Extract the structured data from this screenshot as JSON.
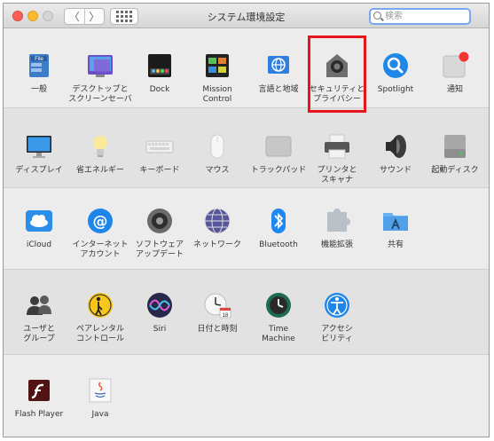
{
  "window": {
    "title": "システム環境設定"
  },
  "toolbar": {
    "back": "〈",
    "forward": "〉"
  },
  "search": {
    "placeholder": "検索"
  },
  "rows": [
    [
      {
        "name": "general",
        "label": "一般",
        "icon": "general-icon"
      },
      {
        "name": "desktop-screensaver",
        "label": "デスクトップと\nスクリーンセーバ",
        "icon": "desktop-icon"
      },
      {
        "name": "dock",
        "label": "Dock",
        "icon": "dock-icon"
      },
      {
        "name": "mission-control",
        "label": "Mission\nControl",
        "icon": "mission-control-icon"
      },
      {
        "name": "language-region",
        "label": "言語と地域",
        "icon": "flag-icon"
      },
      {
        "name": "security-privacy",
        "label": "セキュリティと\nプライバシー",
        "icon": "house-lock-icon"
      },
      {
        "name": "spotlight",
        "label": "Spotlight",
        "icon": "magnifier-icon"
      },
      {
        "name": "notifications",
        "label": "通知",
        "icon": "notifications-icon"
      }
    ],
    [
      {
        "name": "displays",
        "label": "ディスプレイ",
        "icon": "display-icon"
      },
      {
        "name": "energy-saver",
        "label": "省エネルギー",
        "icon": "lightbulb-icon"
      },
      {
        "name": "keyboard",
        "label": "キーボード",
        "icon": "keyboard-icon"
      },
      {
        "name": "mouse",
        "label": "マウス",
        "icon": "mouse-icon"
      },
      {
        "name": "trackpad",
        "label": "トラックパッド",
        "icon": "trackpad-icon"
      },
      {
        "name": "printers-scanners",
        "label": "プリンタと\nスキャナ",
        "icon": "printer-icon"
      },
      {
        "name": "sound",
        "label": "サウンド",
        "icon": "speaker-icon"
      },
      {
        "name": "startup-disk",
        "label": "起動ディスク",
        "icon": "disk-icon"
      }
    ],
    [
      {
        "name": "icloud",
        "label": "iCloud",
        "icon": "cloud-icon"
      },
      {
        "name": "internet-accounts",
        "label": "インターネット\nアカウント",
        "icon": "at-icon"
      },
      {
        "name": "software-update",
        "label": "ソフトウェア\nアップデート",
        "icon": "gear-icon"
      },
      {
        "name": "network",
        "label": "ネットワーク",
        "icon": "globe-icon"
      },
      {
        "name": "bluetooth",
        "label": "Bluetooth",
        "icon": "bluetooth-icon"
      },
      {
        "name": "extensions",
        "label": "機能拡張",
        "icon": "puzzle-icon"
      },
      {
        "name": "sharing",
        "label": "共有",
        "icon": "sharing-folder-icon"
      }
    ],
    [
      {
        "name": "users-groups",
        "label": "ユーザと\nグループ",
        "icon": "users-icon"
      },
      {
        "name": "parental-controls",
        "label": "ペアレンタル\nコントロール",
        "icon": "parental-icon"
      },
      {
        "name": "siri",
        "label": "Siri",
        "icon": "siri-icon"
      },
      {
        "name": "date-time",
        "label": "日付と時刻",
        "icon": "clock-icon"
      },
      {
        "name": "time-machine",
        "label": "Time\nMachine",
        "icon": "time-machine-icon"
      },
      {
        "name": "accessibility",
        "label": "アクセシ\nビリティ",
        "icon": "accessibility-icon"
      }
    ],
    [
      {
        "name": "flash-player",
        "label": "Flash Player",
        "icon": "flash-icon"
      },
      {
        "name": "java",
        "label": "Java",
        "icon": "java-icon"
      }
    ]
  ]
}
